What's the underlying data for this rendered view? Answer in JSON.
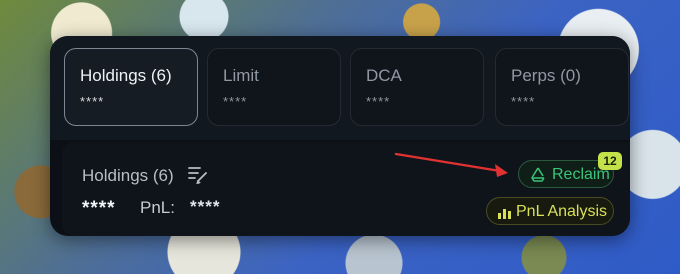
{
  "tabs": [
    {
      "label": "Holdings (6)",
      "value": "****",
      "active": true
    },
    {
      "label": "Limit",
      "value": "****",
      "active": false
    },
    {
      "label": "DCA",
      "value": "****",
      "active": false
    },
    {
      "label": "Perps (0)",
      "value": "****",
      "active": false
    }
  ],
  "holdings": {
    "title": "Holdings (6)",
    "total_value": "****",
    "pnl_label": "PnL:",
    "pnl_value": "****"
  },
  "actions": {
    "reclaim_label": "Reclaim",
    "reclaim_badge": "12",
    "pnl_analysis_label": "PnL Analysis"
  },
  "icons": {
    "edit": "list-edit-icon",
    "reclaim": "recycle-icon",
    "pnl_analysis": "bar-chart-icon"
  },
  "colors": {
    "panel_bg": "#0c1016",
    "reclaim_green": "#39c47a",
    "badge_lime": "#c3e24a",
    "pnl_analysis_yellow": "#d8e05a",
    "annotation_arrow": "#e03232"
  }
}
